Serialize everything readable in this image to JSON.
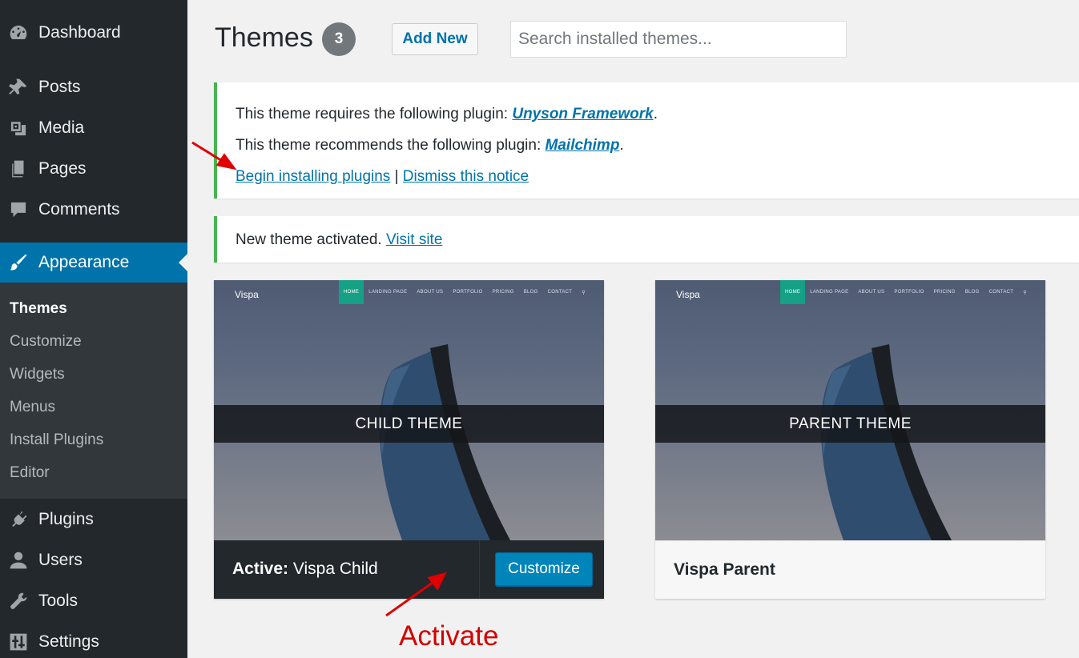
{
  "sidebar": {
    "items": [
      {
        "label": "Dashboard",
        "icon": "dashboard-icon"
      },
      {
        "label": "Posts",
        "icon": "pin-icon"
      },
      {
        "label": "Media",
        "icon": "media-icon"
      },
      {
        "label": "Pages",
        "icon": "pages-icon"
      },
      {
        "label": "Comments",
        "icon": "comment-icon"
      },
      {
        "label": "Appearance",
        "icon": "paintbrush-icon"
      },
      {
        "label": "Plugins",
        "icon": "plugin-icon"
      },
      {
        "label": "Users",
        "icon": "user-icon"
      },
      {
        "label": "Tools",
        "icon": "wrench-icon"
      },
      {
        "label": "Settings",
        "icon": "settings-icon"
      }
    ],
    "submenu": [
      "Themes",
      "Customize",
      "Widgets",
      "Menus",
      "Install Plugins",
      "Editor"
    ],
    "active_item": "Appearance",
    "current_subitem": "Themes"
  },
  "header": {
    "title": "Themes",
    "count": "3",
    "add_new": "Add New",
    "search_placeholder": "Search installed themes..."
  },
  "notices": {
    "plugins": {
      "line1_prefix": "This theme requires the following plugin: ",
      "line1_link": "Unyson Framework",
      "line1_suffix": ".",
      "line2_prefix": "This theme recommends the following plugin: ",
      "line2_link": "Mailchimp",
      "line2_suffix": ".",
      "begin_link": "Begin installing plugins",
      "separator": " | ",
      "dismiss_link": "Dismiss this notice"
    },
    "activated": {
      "text": "New theme activated. ",
      "link": "Visit site"
    }
  },
  "themes": [
    {
      "site_logo": "Vispa",
      "nav": [
        "HOME",
        "LANDING PAGE",
        "ABOUT US",
        "PORTFOLIO",
        "PRICING",
        "BLOG",
        "CONTACT"
      ],
      "band": "CHILD THEME",
      "active_label": "Active:",
      "name": " Vispa Child",
      "action": "Customize"
    },
    {
      "site_logo": "Vispa",
      "nav": [
        "HOME",
        "LANDING PAGE",
        "ABOUT US",
        "PORTFOLIO",
        "PRICING",
        "BLOG",
        "CONTACT"
      ],
      "band": "PARENT THEME",
      "name": "Vispa Parent"
    }
  ],
  "annotation": {
    "label": "Activate",
    "color": "#d40000"
  },
  "colors": {
    "sidebar": "#23282d",
    "active": "#0073aa",
    "notice_border": "#46b450",
    "button_primary": "#0085ba"
  }
}
